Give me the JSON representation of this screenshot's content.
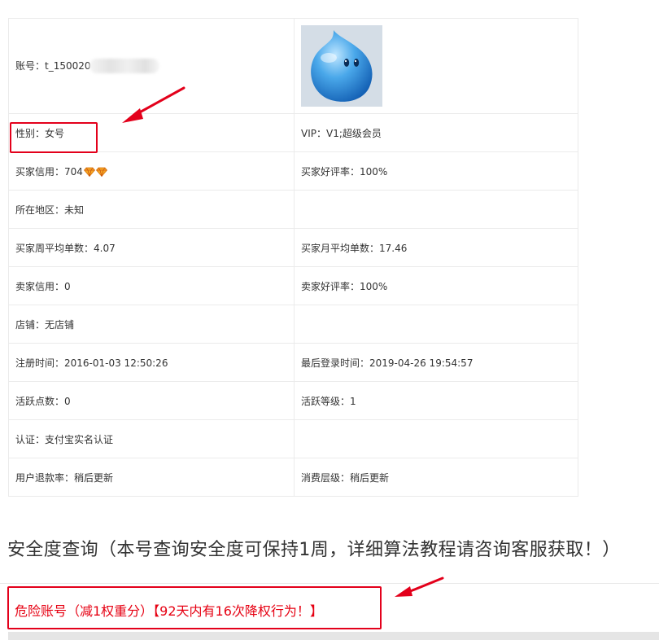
{
  "profile": {
    "account_label": "账号：t_150020",
    "gender": "性别：女号",
    "vip": "VIP：V1;超级会员",
    "buyer_credit": "买家信用：704",
    "buyer_rating": "买家好评率：100%",
    "location": "所在地区：未知",
    "buyer_weekly_avg": "买家周平均单数：4.07",
    "buyer_monthly_avg": "买家月平均单数：17.46",
    "seller_credit": "卖家信用：0",
    "seller_rating": "卖家好评率：100%",
    "shop": "店铺：无店铺",
    "register_time": "注册时间：2016-01-03 12:50:26",
    "last_login": "最后登录时间：2019-04-26 19:54:57",
    "activity_points": "活跃点数：0",
    "activity_level": "活跃等级：1",
    "verification": "认证：支付宝实名认证",
    "refund_rate": "用户退款率：稍后更新",
    "consumption_tier": "消费层级：稍后更新"
  },
  "icons": {
    "avatar": "blue-water-drop-avatar",
    "credit_badge": "diamond-icon"
  },
  "colors": {
    "accent_red": "#e60012",
    "border": "#ebebeb",
    "diamond": "#f39c12"
  },
  "security": {
    "title": "安全度查询（本号查询安全度可保持1周，详细算法教程请咨询客服获取！）",
    "result": "危险账号（减1权重分）【92天内有16次降权行为！】"
  }
}
